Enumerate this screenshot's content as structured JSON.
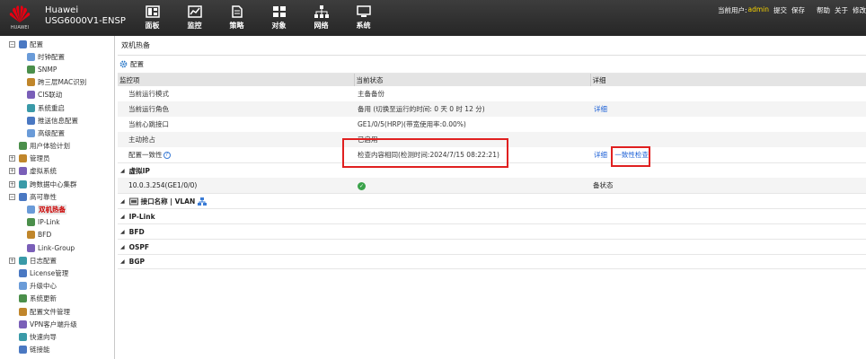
{
  "header": {
    "logo_text": "HUAWEI",
    "brand_line1": "Huawei",
    "brand_line2": "USG6000V1-ENSP",
    "nav": [
      {
        "label": "面板",
        "icon": "dashboard-icon"
      },
      {
        "label": "监控",
        "icon": "monitor-icon"
      },
      {
        "label": "策略",
        "icon": "policy-icon"
      },
      {
        "label": "对象",
        "icon": "object-icon"
      },
      {
        "label": "网络",
        "icon": "network-icon"
      },
      {
        "label": "系统",
        "icon": "system-icon"
      }
    ],
    "current_user_label": "当前用户:",
    "current_user": "admin",
    "submit": "提交",
    "save": "保存",
    "help": "帮助",
    "about": "关于",
    "modify": "修改"
  },
  "sidebar": {
    "items": [
      {
        "label": "配置",
        "level": 0,
        "toggle": "−",
        "icon": "config-icon"
      },
      {
        "label": "时钟配置",
        "level": 1,
        "icon": "clock-icon"
      },
      {
        "label": "SNMP",
        "level": 1,
        "icon": "snmp-icon"
      },
      {
        "label": "跨三层MAC识别",
        "level": 1,
        "icon": "mac-icon"
      },
      {
        "label": "CIS联动",
        "level": 1,
        "icon": "cis-icon"
      },
      {
        "label": "系统重启",
        "level": 1,
        "icon": "restart-icon"
      },
      {
        "label": "推送信息配置",
        "level": 1,
        "icon": "push-icon"
      },
      {
        "label": "高级配置",
        "level": 1,
        "icon": "advanced-icon"
      },
      {
        "label": "用户体验计划",
        "level": 0,
        "icon": "user-experience-icon"
      },
      {
        "label": "管理员",
        "level": 0,
        "toggle": "+",
        "icon": "admin-icon"
      },
      {
        "label": "虚拟系统",
        "level": 0,
        "toggle": "+",
        "icon": "vsys-icon"
      },
      {
        "label": "跨数据中心集群",
        "level": 0,
        "toggle": "+",
        "icon": "cluster-icon"
      },
      {
        "label": "高可靠性",
        "level": 0,
        "toggle": "−",
        "icon": "ha-icon"
      },
      {
        "label": "双机热备",
        "level": 1,
        "icon": "hrp-icon",
        "selected": true
      },
      {
        "label": "IP-Link",
        "level": 1,
        "icon": "iplink-icon"
      },
      {
        "label": "BFD",
        "level": 1,
        "icon": "bfd-icon"
      },
      {
        "label": "Link-Group",
        "level": 1,
        "icon": "linkgroup-icon"
      },
      {
        "label": "日志配置",
        "level": 0,
        "toggle": "+",
        "icon": "log-icon"
      },
      {
        "label": "License管理",
        "level": 0,
        "icon": "license-icon"
      },
      {
        "label": "升级中心",
        "level": 0,
        "icon": "upgrade-icon"
      },
      {
        "label": "系统更新",
        "level": 0,
        "icon": "update-icon"
      },
      {
        "label": "配置文件管理",
        "level": 0,
        "icon": "config-file-icon"
      },
      {
        "label": "VPN客户端升级",
        "level": 0,
        "icon": "vpn-icon"
      },
      {
        "label": "快速向导",
        "level": 0,
        "icon": "wizard-icon"
      },
      {
        "label": "链接能",
        "level": 0,
        "icon": "link-icon"
      }
    ]
  },
  "main": {
    "title": "双机热备",
    "toolbar_label": "配置",
    "columns": [
      "监控项",
      "当前状态",
      "详细"
    ],
    "rows": [
      {
        "item": "当前运行模式",
        "status": "主备备份",
        "detail": ""
      },
      {
        "item": "当前运行角色",
        "status": "备用 (切换至运行的时间: 0 天 0 时 12 分)",
        "detail": "详细"
      },
      {
        "item": "当前心跳接口",
        "status": "GE1/0/5(HRP)(带宽使用率:0.00%)",
        "detail": ""
      },
      {
        "item": "主动抢占",
        "status": "已启用",
        "detail": ""
      },
      {
        "item": "配置一致性",
        "status": "检查内容相同(检测时间:2024/7/15 08:22:21)",
        "detail": "详细",
        "detail2": "一致性检查"
      }
    ],
    "vip_section": "虚拟IP",
    "vip_row": {
      "ip": "10.0.3.254(GE1/0/0)",
      "state": "备状态"
    },
    "iface_section": "接口名称 | VLAN",
    "sections": [
      "IP-Link",
      "BFD",
      "OSPF",
      "BGP"
    ]
  }
}
